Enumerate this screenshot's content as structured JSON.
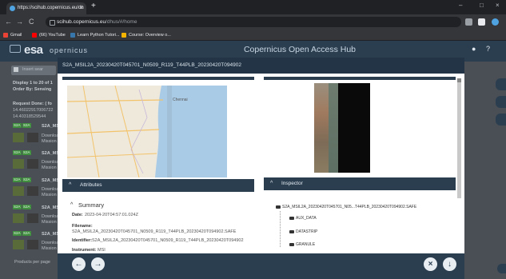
{
  "browser": {
    "tab_title": "https://scihub.copernicus.eu/dh",
    "tab_close": "×",
    "new_tab": "+",
    "win_min": "–",
    "win_max": "□",
    "win_close": "×",
    "back": "←",
    "forward": "→",
    "reload": "C",
    "url_host": "scihub.copernicus.eu",
    "url_path": "/dhus/#/home",
    "bookmarks": [
      {
        "label": "Gmail",
        "color": "#ea4335"
      },
      {
        "label": "(66) YouTube",
        "color": "#ff0000"
      },
      {
        "label": "Learn Python Tutori...",
        "color": "#3776ab"
      },
      {
        "label": "Course: Overview o...",
        "color": "#f4b400"
      }
    ]
  },
  "hub": {
    "logo": "esa",
    "logo_sub": "opernicus",
    "title": "Copernicus Open Access Hub"
  },
  "background_list": {
    "search_placeholder": "Insert sear",
    "display_line": "Display 1 to 20 of 1",
    "order_line": "Order By: Sensing",
    "request_line": "Request Done: ( fo",
    "coords1": "14.46022917006722",
    "coords2": "14.40318529544",
    "items": [
      {
        "tag": "S2A",
        "name": "S2A_MSI",
        "sub": "Downloa",
        "sub2": "Mission"
      },
      {
        "tag": "S2A",
        "name": "S2A_MSI",
        "sub": "Downloa",
        "sub2": "Mission"
      },
      {
        "tag": "S2A",
        "name": "S2A_MSI",
        "sub": "Downloa",
        "sub2": "Mission"
      },
      {
        "tag": "S2A",
        "name": "S2A_MSI",
        "sub": "Downloa",
        "sub2": "Mission"
      },
      {
        "tag": "S2A",
        "name": "S2A_MSI",
        "sub": "Downloa",
        "sub2": "Mission"
      }
    ],
    "products_per_page": "Products per page"
  },
  "modal": {
    "title": "S2A_MSIL2A_20230420T045701_N0509_R119_T44PLB_20230420T094902",
    "attributes_header": "Attributes",
    "inspector_header": "Inspector",
    "summary_title": "Summary",
    "date_label": "Date:",
    "date_value": "2023-04-20T04:57:01.024Z",
    "filename_label": "Filename:",
    "filename_value": "S2A_MSIL2A_20230420T045701_N0509_R119_T44PLB_20230420T094902.SAFE",
    "identifier_label": "Identifier:",
    "identifier_value": "S2A_MSIL2A_20230420T045701_N0509_R119_T44PLB_20230420T094902",
    "instrument_label": "Instrument:",
    "instrument_value": "MSI",
    "tree_root": "S2A_MSIL2A_20230420T045701_N05...T44PLB_20230420T094902.SAFE",
    "tree_items": [
      "AUX_DATA",
      "DATASTRIP",
      "GRANULE"
    ],
    "map_city": "Chennai"
  },
  "footer": {
    "prev": "←",
    "next": "→",
    "close": "×",
    "download": "↓"
  },
  "colors": {
    "hub_bar": "#2b3e50",
    "modal_header": "#223445",
    "accent_tag": "#3f8f3f"
  }
}
